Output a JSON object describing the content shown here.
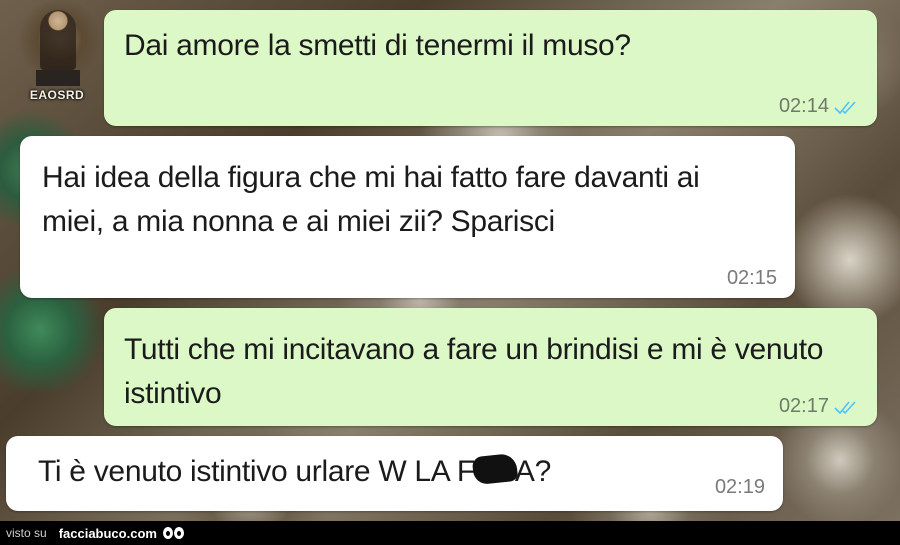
{
  "watermark": {
    "brand": "EAOSRD"
  },
  "messages": [
    {
      "direction": "outgoing",
      "text": "Dai amore la smetti di tenermi il muso?",
      "time": "02:14",
      "ticks": "double-check-icon"
    },
    {
      "direction": "incoming",
      "text": "Hai idea della figura che mi hai fatto fare davanti ai miei, a mia nonna e ai miei zii? Sparisci",
      "time": "02:15"
    },
    {
      "direction": "outgoing",
      "text": "Tutti che mi incitavano a fare un brindisi e mi è venuto istintivo",
      "time": "02:17",
      "ticks": "double-check-icon"
    },
    {
      "direction": "incoming",
      "text_before_censor": "Ti è venuto istintivo urlare W LA F",
      "text_after_censor": "A?",
      "time": "02:19"
    }
  ],
  "footer": {
    "label": "visto su",
    "site": "facciabuco.com"
  },
  "colors": {
    "outgoing_bubble": "#dcf8c6",
    "incoming_bubble": "#ffffff",
    "read_ticks": "#4fc3f7"
  }
}
